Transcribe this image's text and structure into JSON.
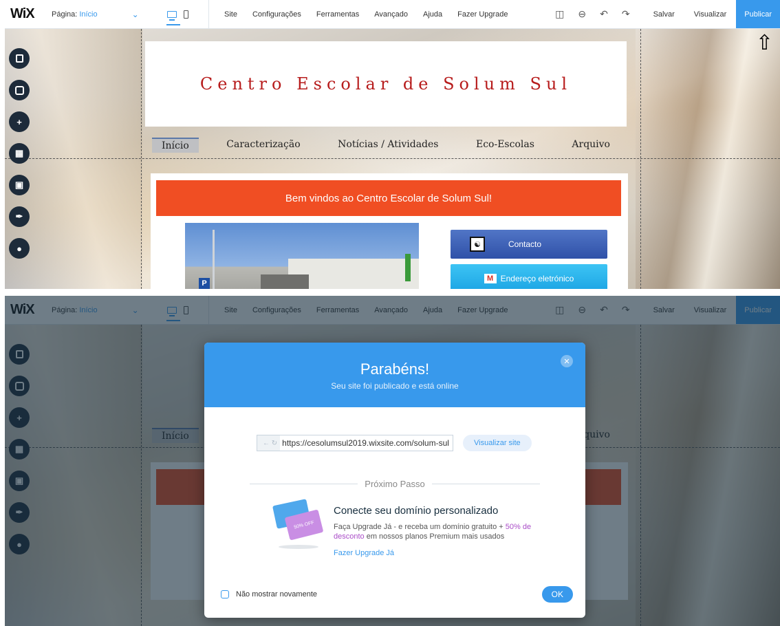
{
  "topbar": {
    "logo": "WiX",
    "page_label": "Página:",
    "page_value": "Início",
    "menu": [
      "Site",
      "Configurações",
      "Ferramentas",
      "Avançado",
      "Ajuda",
      "Fazer Upgrade"
    ],
    "save": "Salvar",
    "preview": "Visualizar",
    "publish": "Publicar"
  },
  "site": {
    "title": "Centro Escolar de Solum Sul",
    "nav": [
      "Início",
      "Caracterização",
      "Notícias / Atividades",
      "Eco-Escolas",
      "Arquivo"
    ],
    "banner": "Bem vindos ao Centro Escolar de Solum Sul!",
    "contact_button": "Contacto",
    "email_button": "Endereço eletrónico",
    "photo_sign": "P"
  },
  "modal": {
    "title": "Parabéns!",
    "subtitle": "Seu site foi publicado e está online",
    "url": "https://cesolumsul2019.wixsite.com/solum-sul",
    "view_site": "Visualizar site",
    "next_step": "Próximo Passo",
    "promo_badge": "50% OFF",
    "promo_title": "Conecte seu domínio personalizado",
    "promo_desc_1": "Faça Upgrade Já - e receba um domínio gratuito +",
    "promo_desc_highlight": "50% de desconto",
    "promo_desc_2": "em nossos planos Premium mais usados",
    "upgrade_link": "Fazer Upgrade Já",
    "dont_show": "Não mostrar novamente",
    "ok": "OK"
  },
  "colors": {
    "accent": "#3899ec",
    "banner": "#f04e23",
    "title_red": "#b71c1c",
    "promo_highlight": "#aa4dc8"
  }
}
